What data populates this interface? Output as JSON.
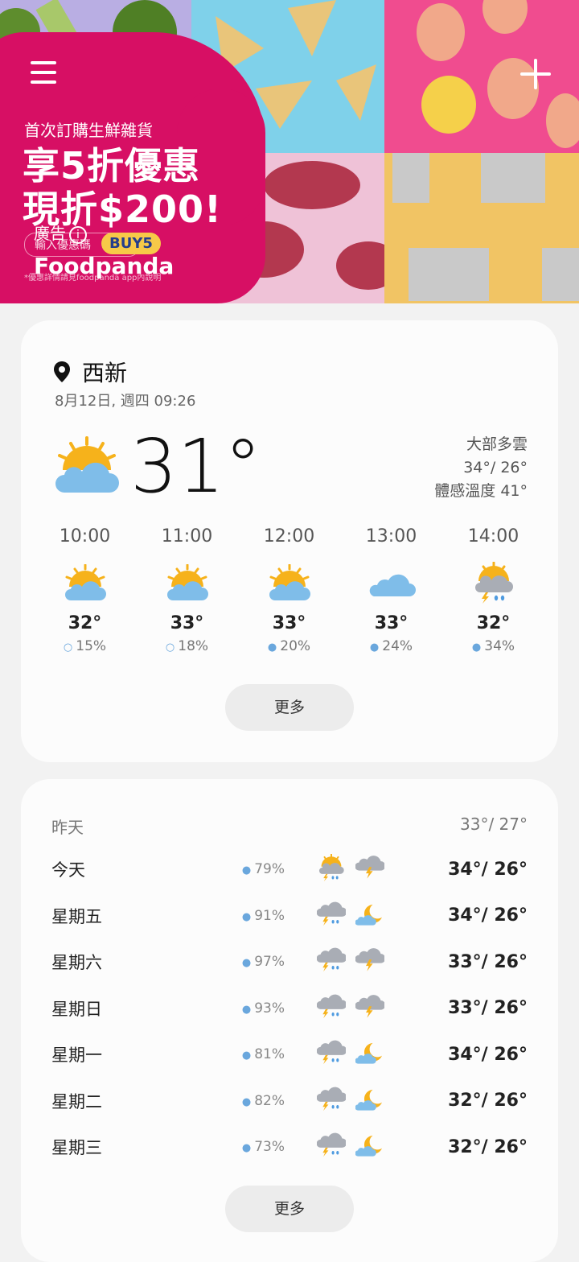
{
  "banner": {
    "promo_line": "首次訂購生鮮雜貨",
    "promo_big_1": "享5折優惠",
    "promo_big_2": "現折$200!",
    "ad_label": "廣告",
    "code_hint": "輸入優惠碼",
    "code": "BUY5",
    "brand": "Foodpanda",
    "fine_print": "*優惠詳情請見foodpanda app內說明"
  },
  "current": {
    "location": "西新",
    "datetime": "8月12日, 週四 09:26",
    "temp": "31°",
    "condition": "大部多雲",
    "hi_lo": "34°/ 26°",
    "feels_like": "體感溫度 41°"
  },
  "hourly": [
    {
      "time": "10:00",
      "temp": "32°",
      "rain": "15%",
      "icon": "partly-sunny-icon"
    },
    {
      "time": "11:00",
      "temp": "33°",
      "rain": "18%",
      "icon": "partly-sunny-icon"
    },
    {
      "time": "12:00",
      "temp": "33°",
      "rain": "20%",
      "icon": "partly-sunny-icon"
    },
    {
      "time": "13:00",
      "temp": "33°",
      "rain": "24%",
      "icon": "cloud-icon"
    },
    {
      "time": "14:00",
      "temp": "32°",
      "rain": "34%",
      "icon": "sun-thunder-rain-icon"
    }
  ],
  "more_label": "更多",
  "yesterday": {
    "label": "昨天",
    "hi_lo": "33°/ 27°"
  },
  "daily": [
    {
      "day": "今天",
      "rain": "79%",
      "day_icon": "sun-thunder-rain-icon",
      "night_icon": "cloud-thunder-icon",
      "hi_lo": "34°/ 26°"
    },
    {
      "day": "星期五",
      "rain": "91%",
      "day_icon": "thunder-rain-icon",
      "night_icon": "moon-cloud-icon",
      "hi_lo": "34°/ 26°"
    },
    {
      "day": "星期六",
      "rain": "97%",
      "day_icon": "thunder-rain-icon",
      "night_icon": "cloud-thunder-icon",
      "hi_lo": "33°/ 26°"
    },
    {
      "day": "星期日",
      "rain": "93%",
      "day_icon": "thunder-rain-icon",
      "night_icon": "cloud-thunder-icon",
      "hi_lo": "33°/ 26°"
    },
    {
      "day": "星期一",
      "rain": "81%",
      "day_icon": "thunder-rain-icon",
      "night_icon": "moon-cloud-icon",
      "hi_lo": "34°/ 26°"
    },
    {
      "day": "星期二",
      "rain": "82%",
      "day_icon": "thunder-rain-icon",
      "night_icon": "moon-cloud-icon",
      "hi_lo": "32°/ 26°"
    },
    {
      "day": "星期三",
      "rain": "73%",
      "day_icon": "thunder-rain-icon",
      "night_icon": "moon-cloud-icon",
      "hi_lo": "32°/ 26°"
    }
  ],
  "colors": {
    "brand": "#d70f64",
    "cloud": "#7fbde9",
    "sun": "#f6b21b",
    "rain": "#6aa7dd"
  }
}
